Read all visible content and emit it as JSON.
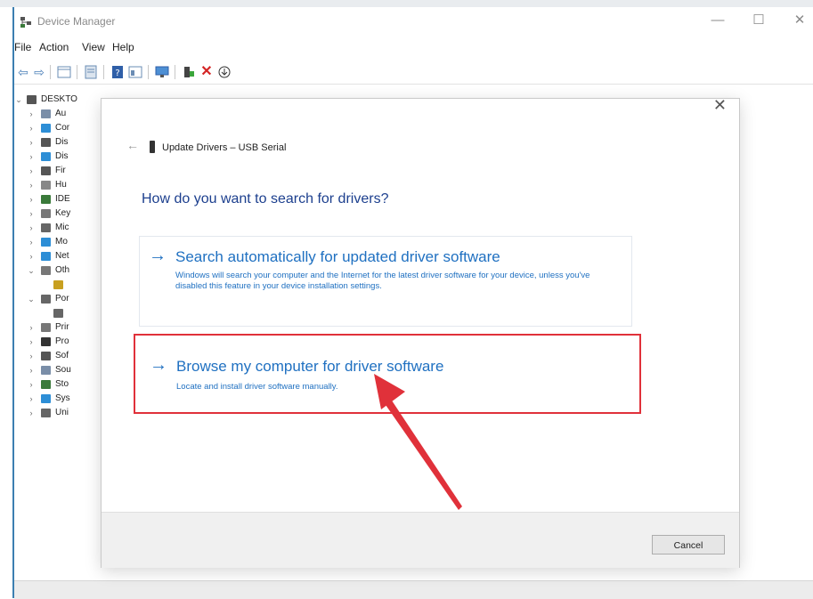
{
  "window": {
    "title": "Device Manager",
    "controls": {
      "minimize": "—",
      "maximize": "☐",
      "close": "✕"
    }
  },
  "menu": {
    "items": [
      "File",
      "Action",
      "View",
      "Help"
    ]
  },
  "tree": {
    "root": "DESKTO",
    "items": [
      {
        "label": "Au",
        "color": "#7a8ea8"
      },
      {
        "label": "Cor",
        "color": "#2d8ed6"
      },
      {
        "label": "Dis",
        "color": "#555555"
      },
      {
        "label": "Dis",
        "color": "#2d8ed6"
      },
      {
        "label": "Fir",
        "color": "#555555"
      },
      {
        "label": "Hu",
        "color": "#888888"
      },
      {
        "label": "IDE",
        "color": "#3a7a3a"
      },
      {
        "label": "Key",
        "color": "#777777"
      },
      {
        "label": "Mic",
        "color": "#666666"
      },
      {
        "label": "Mo",
        "color": "#2d8ed6"
      },
      {
        "label": "Net",
        "color": "#2d8ed6"
      },
      {
        "label": "Oth",
        "color": "#777777"
      },
      {
        "label": "",
        "color": "#c8a020"
      },
      {
        "label": "Por",
        "color": "#666666"
      },
      {
        "label": "",
        "color": "#666666"
      },
      {
        "label": "Prir",
        "color": "#777777"
      },
      {
        "label": "Pro",
        "color": "#333333"
      },
      {
        "label": "Sof",
        "color": "#555555"
      },
      {
        "label": "Sou",
        "color": "#7a8ea8"
      },
      {
        "label": "Sto",
        "color": "#3a7a3a"
      },
      {
        "label": "Sys",
        "color": "#2d8ed6"
      },
      {
        "label": "Uni",
        "color": "#666666"
      }
    ]
  },
  "dialog": {
    "close": "✕",
    "back": "←",
    "title": "Update Drivers – USB Serial",
    "heading": "How do you want to search for drivers?",
    "options": [
      {
        "arrow": "→",
        "title": "Search automatically for updated driver software",
        "description": "Windows will search your computer and the Internet for the latest driver software for your device, unless you've disabled this feature in your device installation settings."
      },
      {
        "arrow": "→",
        "title": "Browse my computer for driver software",
        "description": "Locate and install driver software manually."
      }
    ],
    "cancel": "Cancel"
  },
  "colors": {
    "link_blue": "#1f70c1",
    "heading_blue": "#1c3f8e",
    "highlight_red": "#e0313a"
  }
}
